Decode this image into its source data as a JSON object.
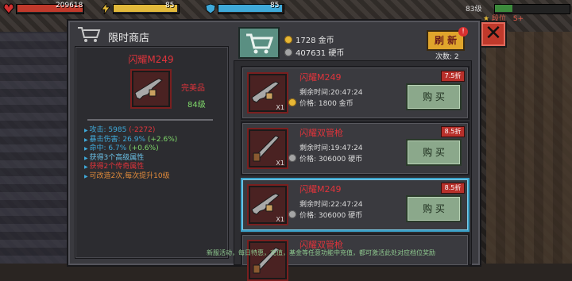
{
  "hud": {
    "hp_value": "209618",
    "energy_value": "85",
    "shield_value": "85",
    "level_text": "83级",
    "rank_label": "段位",
    "rank_value": "S+"
  },
  "shop": {
    "title": "限时商店",
    "close_icon": "close-icon",
    "gold_amount": "1728 金币",
    "silver_amount": "407631 硬币",
    "refresh_label": "刷 新",
    "refresh_badge": "!",
    "refresh_count": "次数: 2"
  },
  "detail": {
    "name": "闪耀M249",
    "quality": "完美品",
    "level": "84级",
    "stats": [
      {
        "text": "攻击: 5985",
        "extra": " (-2272)",
        "color": "#3fa9d9",
        "extra_color": "#e0343b"
      },
      {
        "text": "暴击伤害: 26.9%",
        "extra": " (+2.6%)",
        "color": "#3fa9d9",
        "extra_color": "#7fd86a"
      },
      {
        "text": "命中: 6.7%",
        "extra": " (+0.6%)",
        "color": "#3fa9d9",
        "extra_color": "#7fd86a"
      },
      {
        "text": "获得3个高级属性",
        "extra": "",
        "color": "#6bc0e6",
        "extra_color": ""
      },
      {
        "text": "获得2个传奇属性",
        "extra": "",
        "color": "#e0343b",
        "extra_color": ""
      },
      {
        "text": "可改造2次,每次提升10级",
        "extra": "",
        "color": "#e08a3a",
        "extra_color": ""
      }
    ]
  },
  "items": [
    {
      "name": "闪耀M249",
      "time": "剩余时间:20:47:24",
      "price": "价格: 1800 金币",
      "coin": "gold",
      "discount": "7.5折",
      "buy": "购 买",
      "qty": "X1",
      "selected": false
    },
    {
      "name": "闪耀双管枪",
      "time": "剩余时间:19:47:24",
      "price": "价格: 306000 硬币",
      "coin": "silver",
      "discount": "8.5折",
      "buy": "购 买",
      "qty": "X1",
      "selected": false
    },
    {
      "name": "闪耀M249",
      "time": "剩余时间:22:47:24",
      "price": "价格: 306000 硬币",
      "coin": "silver",
      "discount": "8.5折",
      "buy": "购 买",
      "qty": "X1",
      "selected": true
    },
    {
      "name": "闪耀双管枪",
      "time": "",
      "price": "",
      "coin": "silver",
      "discount": "",
      "buy": "",
      "qty": "",
      "selected": false
    }
  ],
  "ticker": "新服活动，每日特惠，充值，基金等任意功能中充值，都可激活此处对应档位奖励",
  "colors": {
    "accent_red": "#e0343b",
    "selected_border": "#3aa0c8",
    "button_green": "#8ba88b"
  }
}
